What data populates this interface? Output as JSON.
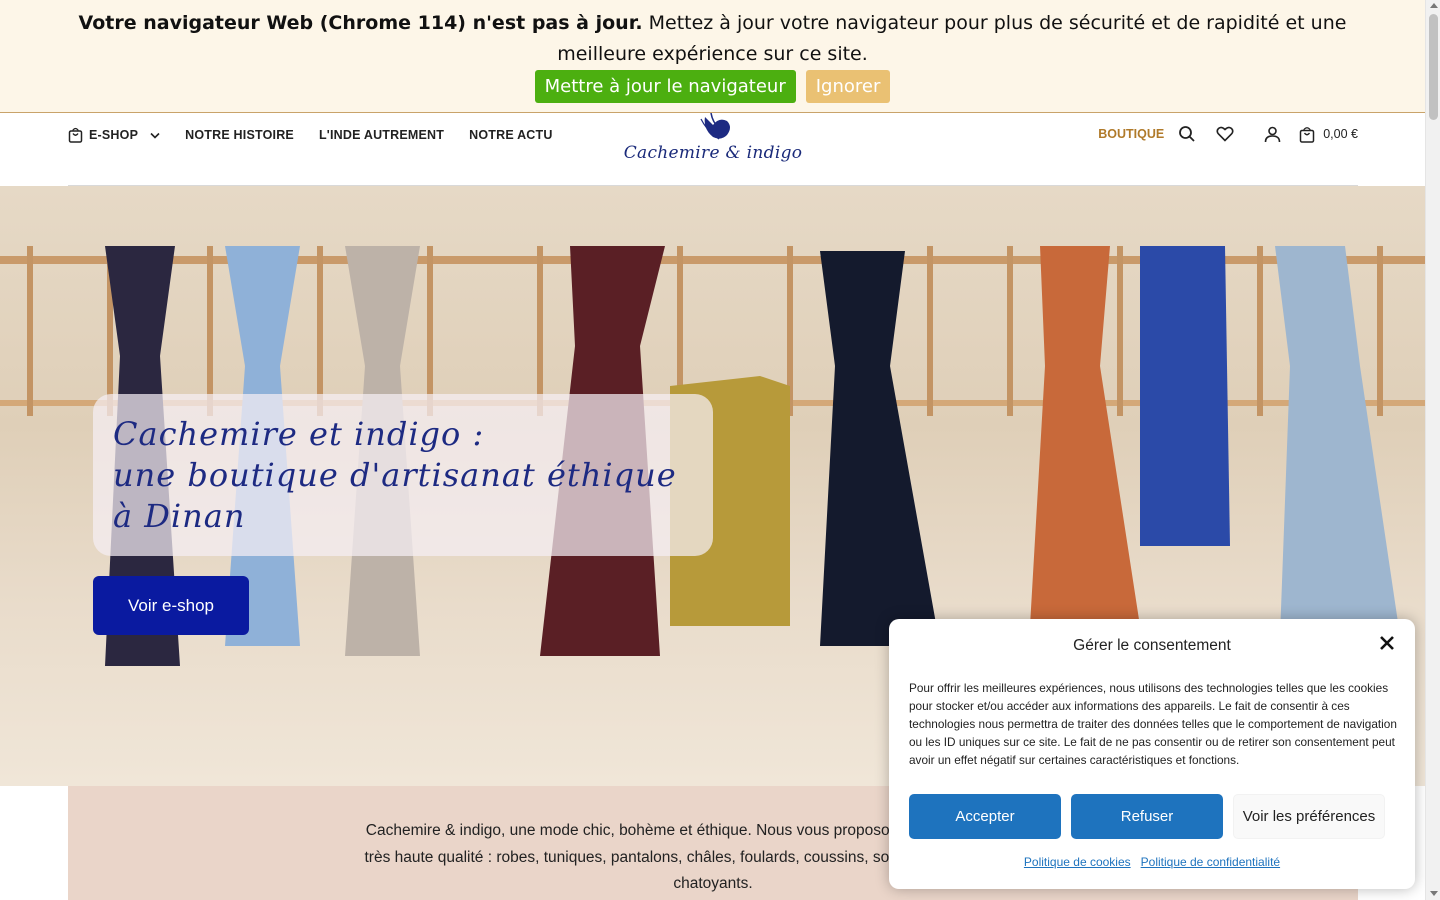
{
  "update_banner": {
    "bold_text": "Votre navigateur Web (Chrome 114) n'est pas à jour.",
    "text": " Mettez à jour votre navigateur pour plus de sécurité et de rapidité et une meilleure expérience sur ce site.",
    "update_label": "Mettre à jour le navigateur",
    "ignore_label": "Ignorer",
    "update_color": "#4caf10",
    "ignore_color": "#eac173"
  },
  "header": {
    "nav": [
      {
        "label": "E-SHOP",
        "icon": "shopping-bag-icon",
        "dropdown": true
      },
      {
        "label": "NOTRE HISTOIRE"
      },
      {
        "label": "L'INDE AUTREMENT"
      },
      {
        "label": "NOTRE ACTU"
      }
    ],
    "logo_text": "Cachemire & indigo",
    "boutique_label": "BOUTIQUE",
    "cart_total": "0,00 €",
    "icons": [
      "search-icon",
      "heart-icon",
      "user-icon",
      "shopping-bag-icon"
    ]
  },
  "hero": {
    "title_line1": "Cachemire et indigo :",
    "title_line2": "une boutique d'artisanat éthique",
    "title_line3": "à Dinan",
    "button_label": "Voir e-shop",
    "button_color": "#0a1aa0"
  },
  "intro": {
    "line1": "Cachemire & indigo, une mode chic, bohème et éthique. Nous vous proposons des vêtements, acces",
    "line2": "très haute qualité : robes, tuniques, pantalons, châles, foulards, coussins, sont réalisés en cachemire,",
    "line3": "chatoyants."
  },
  "consent": {
    "title": "Gérer le consentement",
    "body": "Pour offrir les meilleures expériences, nous utilisons des technologies telles que les cookies pour stocker et/ou accéder aux informations des appareils. Le fait de consentir à ces technologies nous permettra de traiter des données telles que le comportement de navigation ou les ID uniques sur ce site. Le fait de ne pas consentir ou de retirer son consentement peut avoir un effet négatif sur certaines caractéristiques et fonctions.",
    "accept_label": "Accepter",
    "refuse_label": "Refuser",
    "prefs_label": "Voir les préférences",
    "cookie_policy": "Politique de cookies",
    "privacy_policy": "Politique de confidentialité",
    "accent_color": "#1e73be"
  }
}
